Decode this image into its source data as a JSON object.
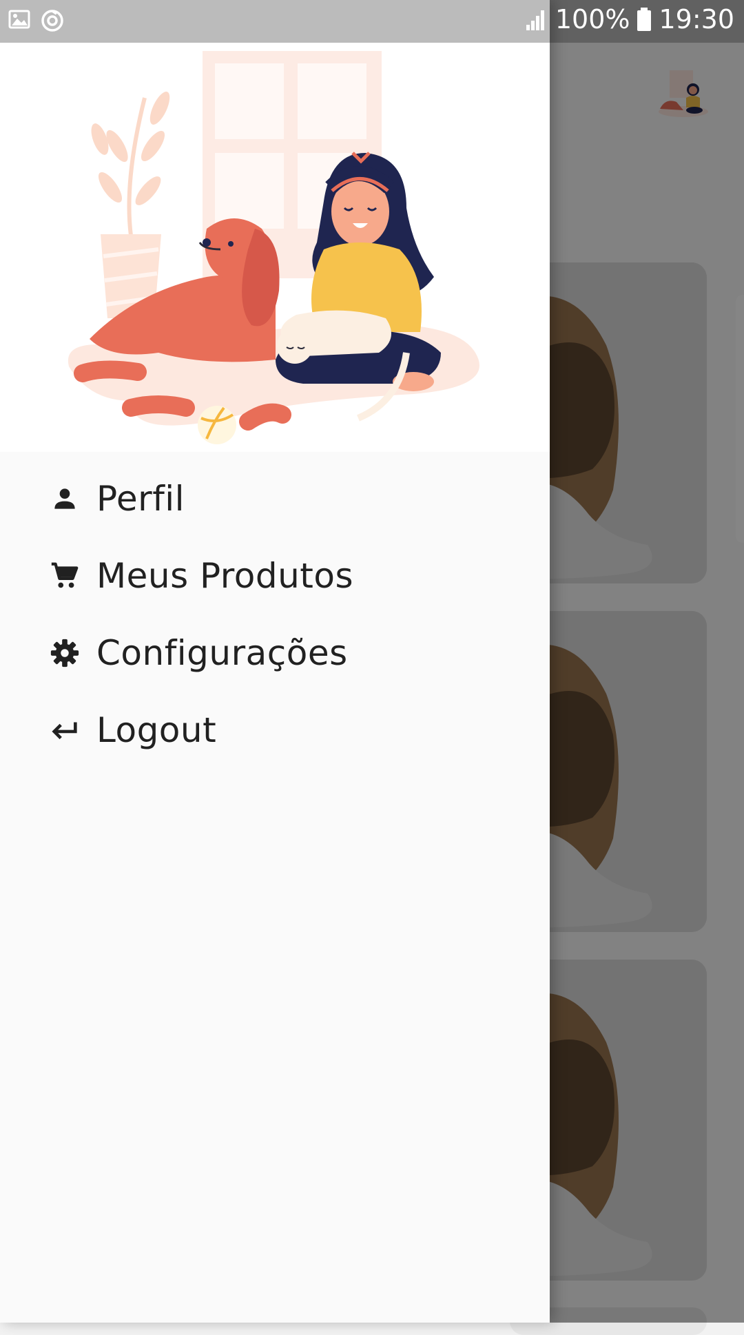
{
  "status_bar": {
    "left_icons": [
      "image-icon",
      "sync-icon"
    ],
    "signal_icon": "signal-icon",
    "battery_percent": "100%",
    "battery_icon": "battery-icon",
    "time": "19:30"
  },
  "drawer": {
    "header_illustration": "girl-with-dog-and-cat-illustration",
    "menu": [
      {
        "label": "Perfil",
        "icon": "person-icon"
      },
      {
        "label": "Meus Produtos",
        "icon": "cart-icon"
      },
      {
        "label": "Configurações",
        "icon": "gear-icon"
      },
      {
        "label": "Logout",
        "icon": "logout-arrow-icon"
      }
    ]
  },
  "background_app": {
    "logo": "app-logo-icon",
    "cards": [
      "puppy-photo",
      "puppy-photo",
      "puppy-photo"
    ]
  },
  "colors": {
    "drawer_bg": "#fafafa",
    "header_bg": "#ffffff",
    "text": "#212121",
    "scrim": "rgba(0,0,0,0.48)"
  }
}
